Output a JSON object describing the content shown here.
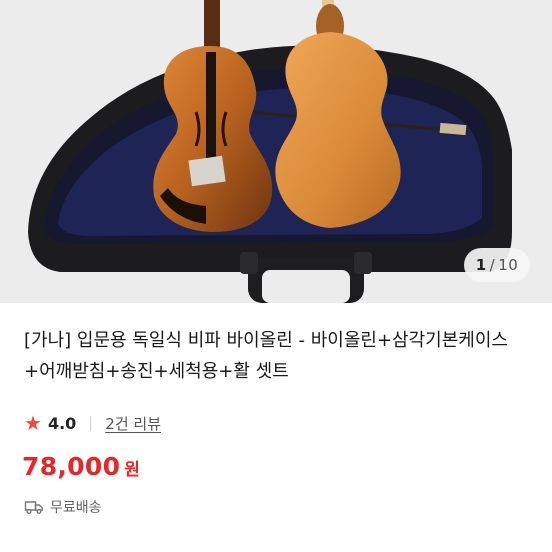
{
  "gallery": {
    "current_index": "1",
    "separator": "/",
    "total": "10"
  },
  "product": {
    "title": "[가나] 입문용 독일식 비파 바이올린 - 바이올린+삼각기본케이스+어깨받침+송진+세척용+활 셋트",
    "rating": "4.0",
    "review_link": "2건 리뷰",
    "price": "78,000",
    "price_unit": "원",
    "shipping": "무료배송"
  },
  "icons": {
    "rating": "star-icon",
    "shipping": "truck-icon"
  },
  "colors": {
    "accent_red": "#e8262a",
    "star": "#f04a3a",
    "text_main": "#1a1a1a",
    "text_muted": "#666666"
  }
}
